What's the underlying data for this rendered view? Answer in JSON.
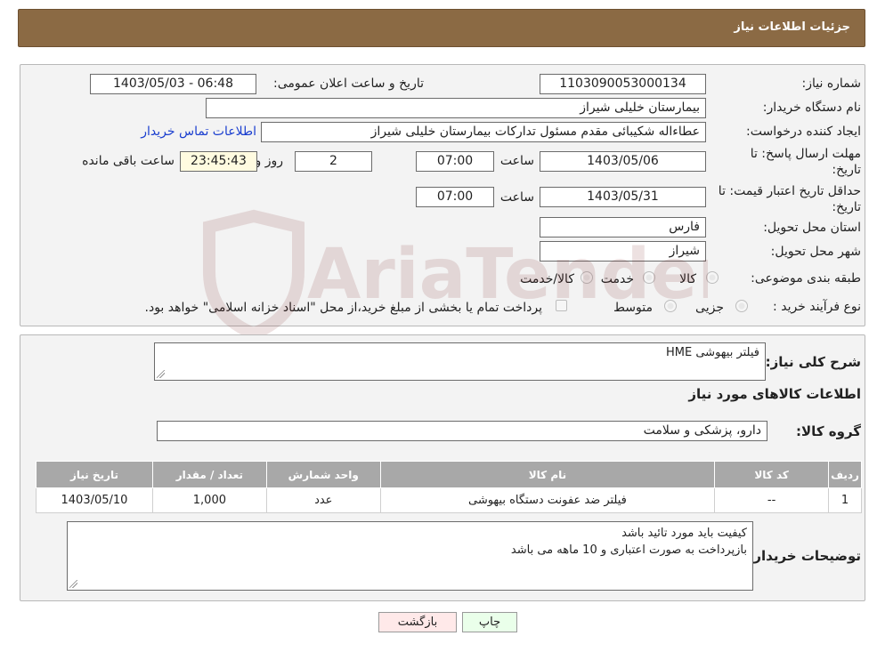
{
  "header": {
    "title": "جزئیات اطلاعات نیاز"
  },
  "info": {
    "need_number_label": "شماره نیاز:",
    "need_number": "1103090053000134",
    "announce_label": "تاریخ و ساعت اعلان عمومی:",
    "announce_value": "1403/05/03 - 06:48",
    "buyer_org_label": "نام دستگاه خریدار:",
    "buyer_org": "بیمارستان خلیلی شیراز",
    "creator_label": "ایجاد کننده درخواست:",
    "creator": "عطاءاله شکیبائی مقدم مسئول تدارکات  بیمارستان خلیلی شیراز",
    "contact_link": "اطلاعات تماس خریدار",
    "deadline_label_1": "مهلت ارسال پاسخ: تا",
    "deadline_label_2": "تاریخ:",
    "deadline_date": "1403/05/06",
    "time_label": "ساعت",
    "deadline_time": "07:00",
    "days_value": "2",
    "days_label": "روز و",
    "remaining_time": "23:45:43",
    "remaining_label": "ساعت باقی مانده",
    "validity_label_1": "حداقل تاریخ اعتبار قیمت: تا",
    "validity_label_2": "تاریخ:",
    "validity_date": "1403/05/31",
    "validity_time": "07:00",
    "province_label": "استان محل تحویل:",
    "province": "فارس",
    "city_label": "شهر محل تحویل:",
    "city": "شیراز",
    "category_label": "طبقه بندی موضوعی:",
    "category_options": [
      "کالا",
      "خدمت",
      "کالا/خدمت"
    ],
    "purchase_type_label": "نوع فرآیند خرید :",
    "purchase_options": [
      "جزیی",
      "متوسط"
    ],
    "purchase_note": "پرداخت تمام یا بخشی از مبلغ خرید،از محل \"اسناد خزانه اسلامی\" خواهد بود."
  },
  "details": {
    "summary_label": "شرح کلی نیاز:",
    "summary": "فیلتر بیهوشی HME",
    "goods_info_title": "اطلاعات کالاهای مورد نیاز",
    "goods_group_label": "گروه کالا:",
    "goods_group": "دارو، پزشکی و سلامت",
    "table": {
      "headers": [
        "ردیف",
        "کد کالا",
        "نام کالا",
        "واحد شمارش",
        "تعداد / مقدار",
        "تاریخ نیاز"
      ],
      "rows": [
        [
          "1",
          "--",
          "فیلتر ضد عفونت دستگاه بیهوشی",
          "عدد",
          "1,000",
          "1403/05/10"
        ]
      ]
    },
    "buyer_notes_label": "توضیحات خریدار:",
    "buyer_notes_line1": "کیفیت باید مورد تائید باشد",
    "buyer_notes_line2": "بازپرداخت به صورت اعتباری و 10 ماهه می باشد"
  },
  "buttons": {
    "print": "چاپ",
    "back": "بازگشت"
  },
  "watermark": {
    "text": "AriaTender.neT"
  },
  "colors": {
    "header_bg": "#8b6a44",
    "link": "#1a3ecf",
    "back_button_bg": "#ffe9e9",
    "print_button_bg": "#eaffea"
  }
}
